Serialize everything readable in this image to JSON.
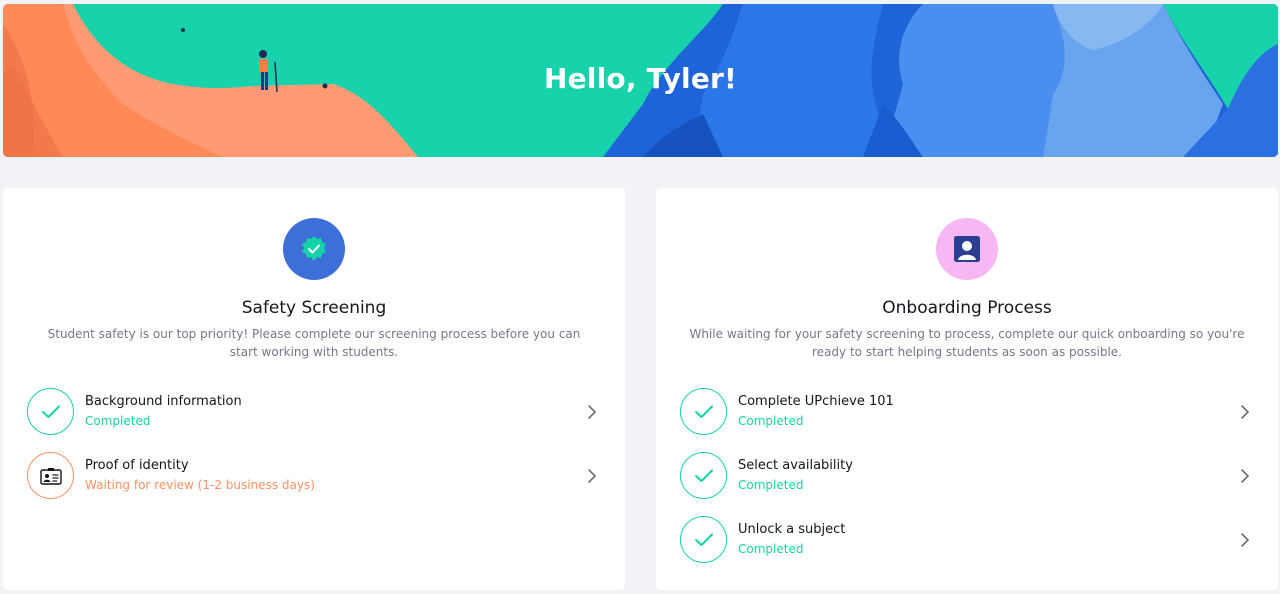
{
  "banner": {
    "greeting": "Hello, Tyler!"
  },
  "safety": {
    "icon": "verified-badge-icon",
    "icon_color": "#3d6fd8",
    "title": "Safety Screening",
    "description": "Student safety is our top priority! Please complete our screening process before you can start working with students.",
    "steps": [
      {
        "title": "Background information",
        "status": "Completed",
        "state": "completed",
        "icon": "check-icon"
      },
      {
        "title": "Proof of identity",
        "status": "Waiting for review (1-2 business days)",
        "state": "pending",
        "icon": "id-card-icon"
      }
    ]
  },
  "onboarding": {
    "icon": "user-portrait-icon",
    "icon_color": "#f7b6f4",
    "title": "Onboarding Process",
    "description": "While waiting for your safety screening to process, complete our quick onboarding so you're ready to start helping students as soon as possible.",
    "steps": [
      {
        "title": "Complete UPchieve 101",
        "status": "Completed",
        "state": "completed",
        "icon": "check-icon"
      },
      {
        "title": "Select availability",
        "status": "Completed",
        "state": "completed",
        "icon": "check-icon"
      },
      {
        "title": "Unlock a subject",
        "status": "Completed",
        "state": "completed",
        "icon": "check-icon"
      }
    ]
  },
  "colors": {
    "accent_green": "#16d2aa",
    "pending_orange": "#fd9164",
    "banner_teal": "#17d2aa",
    "banner_orange": "#ff8a5c",
    "banner_blue": "#2f6fe0"
  }
}
